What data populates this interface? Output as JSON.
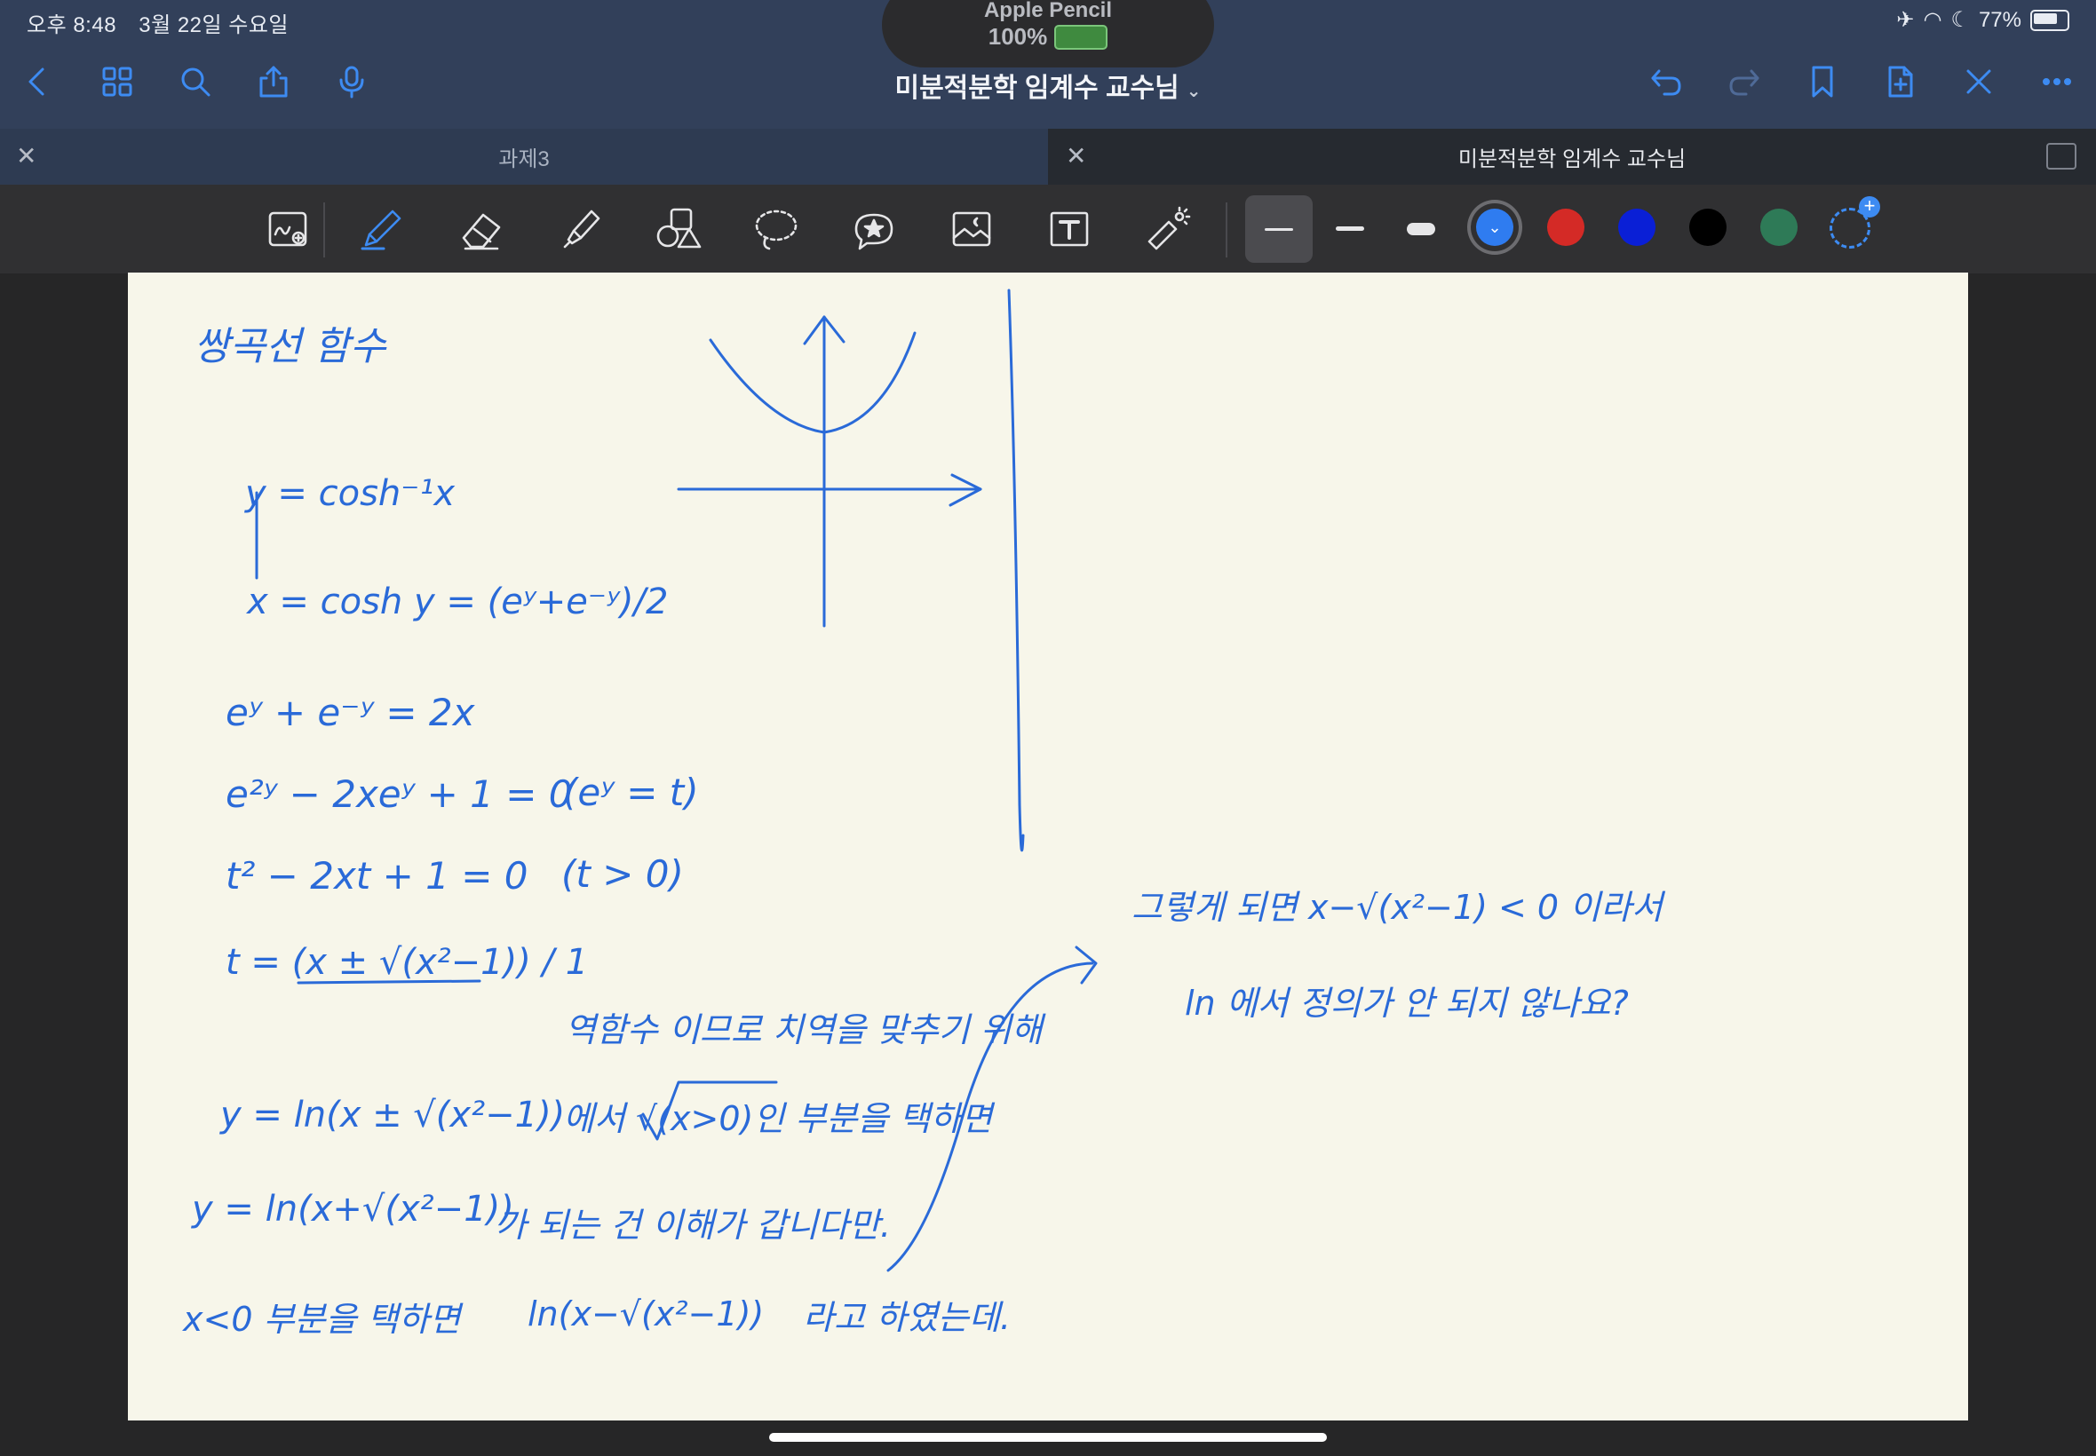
{
  "status": {
    "time": "오후 8:48",
    "date": "3월 22일 수요일",
    "battery": "77%"
  },
  "pencil": {
    "title": "Apple Pencil",
    "battery": "100%"
  },
  "nav": {
    "title": "미분적분학 임계수 교수님",
    "icons": [
      "back-icon",
      "grid-icon",
      "search-icon",
      "share-icon",
      "mic-icon",
      "undo-icon",
      "redo-icon",
      "bookmark-icon",
      "add-page-icon",
      "close-x-icon",
      "more-icon"
    ]
  },
  "tabs": [
    {
      "label": "과제3",
      "active": false
    },
    {
      "label": "미분적분학 임계수 교수님",
      "active": true
    }
  ],
  "toolbar": {
    "tools": [
      "zoom-box-icon",
      "pen-icon",
      "eraser-icon",
      "highlighter-icon",
      "shapes-icon",
      "lasso-icon",
      "sticker-icon",
      "image-icon",
      "text-icon",
      "laser-icon"
    ],
    "selected_tool": "pen-icon",
    "colors": [
      "#2f7cf0",
      "#d42a26",
      "#0a1fd6",
      "#000000",
      "#2e7a57"
    ],
    "selected_color": "#2f7cf0"
  },
  "note": {
    "lines": [
      "쌍곡선 함수",
      "y = cosh⁻¹x",
      "x = cosh y = (eʸ+e⁻ʸ)/2",
      "eʸ + e⁻ʸ = 2x",
      "e²ʸ − 2xeʸ + 1 = 0",
      "(eʸ = t)",
      "t² − 2xt + 1 = 0",
      "(t > 0)",
      "t = (x ± √(x²−1)) / 1",
      "역함수 이므로 치역을 맞추기 위해",
      "y = ln(x ± √(x²−1))",
      "에서 √(x>0)인 부분을 택하면",
      "y = ln(x+√(x²−1))",
      "가 되는 건 이해가 갑니다만.",
      "x<0 부분을 택하면",
      "ln(x−√(x²−1))",
      "라고 하였는데.",
      "그렇게 되면 x−√(x²−1) < 0 이라서",
      "ln 에서 정의가 안 되지 않나요?"
    ]
  }
}
